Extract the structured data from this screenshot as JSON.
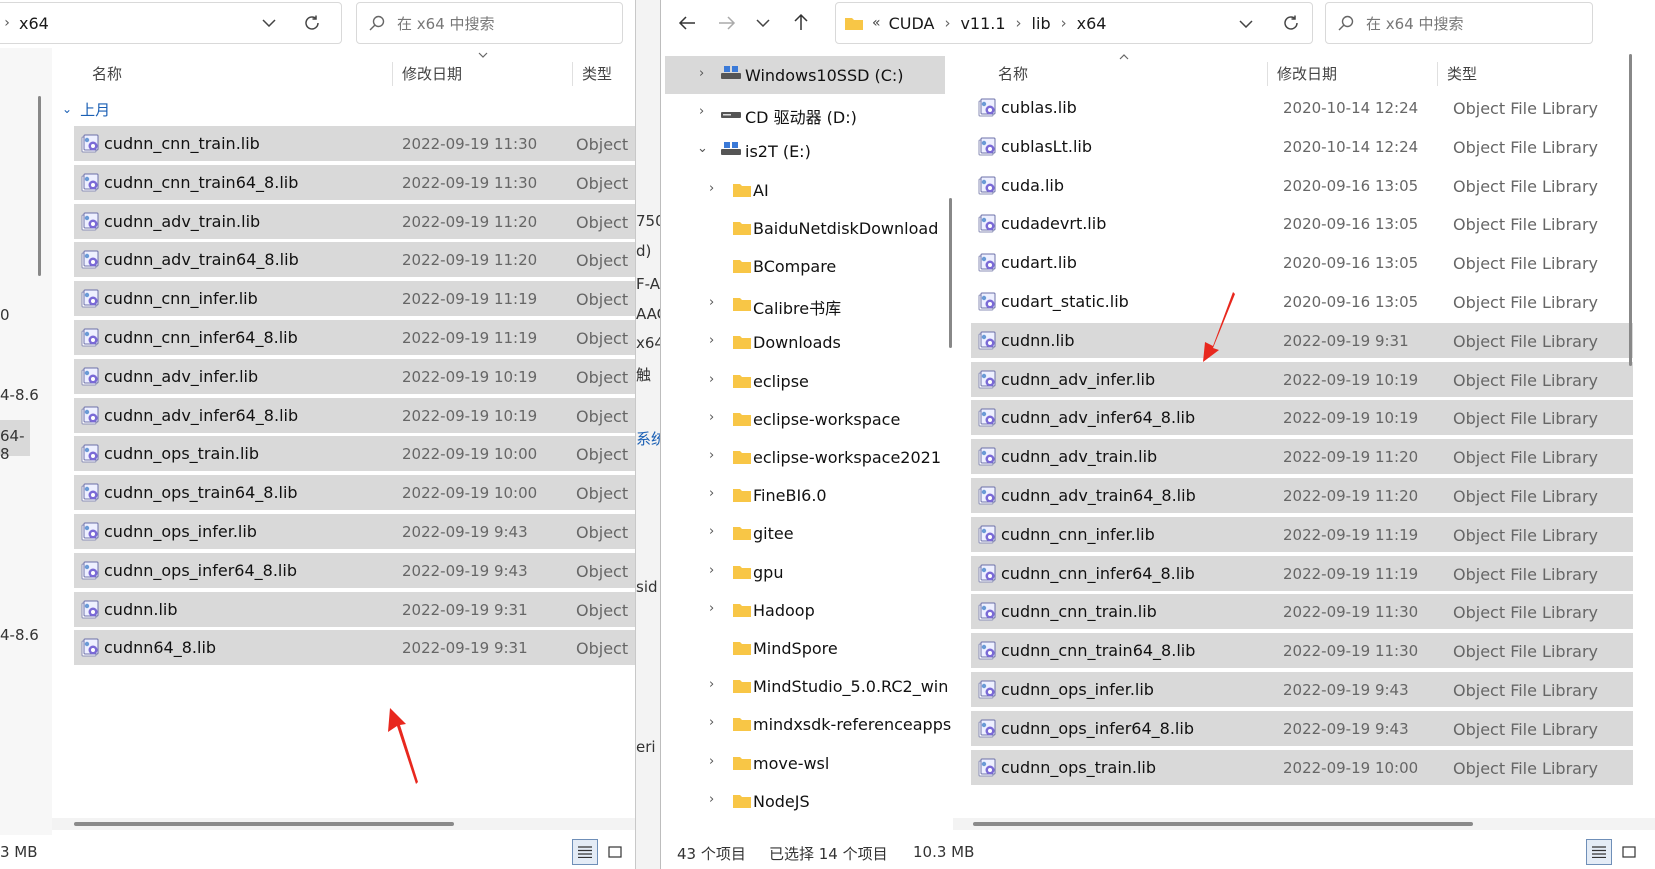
{
  "left": {
    "address": {
      "crumb": "x64"
    },
    "search": {
      "placeholder": "在 x64 中搜索"
    },
    "columns": {
      "name": "名称",
      "date": "修改日期",
      "type": "类型"
    },
    "group": {
      "label": "上月"
    },
    "files": [
      {
        "name": "cudnn_cnn_train.lib",
        "date": "2022-09-19 11:30",
        "type": "Object"
      },
      {
        "name": "cudnn_cnn_train64_8.lib",
        "date": "2022-09-19 11:30",
        "type": "Object"
      },
      {
        "name": "cudnn_adv_train.lib",
        "date": "2022-09-19 11:20",
        "type": "Object"
      },
      {
        "name": "cudnn_adv_train64_8.lib",
        "date": "2022-09-19 11:20",
        "type": "Object"
      },
      {
        "name": "cudnn_cnn_infer.lib",
        "date": "2022-09-19 11:19",
        "type": "Object"
      },
      {
        "name": "cudnn_cnn_infer64_8.lib",
        "date": "2022-09-19 11:19",
        "type": "Object"
      },
      {
        "name": "cudnn_adv_infer.lib",
        "date": "2022-09-19 10:19",
        "type": "Object"
      },
      {
        "name": "cudnn_adv_infer64_8.lib",
        "date": "2022-09-19 10:19",
        "type": "Object"
      },
      {
        "name": "cudnn_ops_train.lib",
        "date": "2022-09-19 10:00",
        "type": "Object"
      },
      {
        "name": "cudnn_ops_train64_8.lib",
        "date": "2022-09-19 10:00",
        "type": "Object"
      },
      {
        "name": "cudnn_ops_infer.lib",
        "date": "2022-09-19 9:43",
        "type": "Object"
      },
      {
        "name": "cudnn_ops_infer64_8.lib",
        "date": "2022-09-19 9:43",
        "type": "Object"
      },
      {
        "name": "cudnn.lib",
        "date": "2022-09-19 9:31",
        "type": "Object"
      },
      {
        "name": "cudnn64_8.lib",
        "date": "2022-09-19 9:31",
        "type": "Object"
      }
    ],
    "status": {
      "size": "3 MB"
    },
    "edge_fragments": [
      "0",
      "4-8.6",
      "64-8",
      "4-8.6"
    ]
  },
  "background_fragments": [
    "750",
    "d)",
    "F-A",
    "AAC",
    "x64",
    "触",
    "系统",
    "sid",
    "eri"
  ],
  "right": {
    "address": {
      "overflow": "«",
      "crumbs": [
        "CUDA",
        "v11.1",
        "lib",
        "x64"
      ]
    },
    "search": {
      "placeholder": "在 x64 中搜索"
    },
    "columns": {
      "name": "名称",
      "date": "修改日期",
      "type": "类型"
    },
    "tree": [
      {
        "label": "Windows10SSD (C:)",
        "kind": "drive",
        "expand": "right",
        "selected": true
      },
      {
        "label": "CD 驱动器 (D:)",
        "kind": "cd",
        "expand": "right"
      },
      {
        "label": "is2T (E:)",
        "kind": "drive",
        "expand": "down"
      },
      {
        "label": "AI",
        "kind": "folder",
        "expand": "right"
      },
      {
        "label": "BaiduNetdiskDownload",
        "kind": "folder",
        "expand": ""
      },
      {
        "label": "BCompare",
        "kind": "folder",
        "expand": ""
      },
      {
        "label": "Calibre书库",
        "kind": "folder",
        "expand": "right"
      },
      {
        "label": "Downloads",
        "kind": "folder",
        "expand": "right"
      },
      {
        "label": "eclipse",
        "kind": "folder",
        "expand": "right"
      },
      {
        "label": "eclipse-workspace",
        "kind": "folder",
        "expand": "right"
      },
      {
        "label": "eclipse-workspace2021",
        "kind": "folder",
        "expand": "right"
      },
      {
        "label": "FineBI6.0",
        "kind": "folder",
        "expand": "right"
      },
      {
        "label": "gitee",
        "kind": "folder",
        "expand": "right"
      },
      {
        "label": "gpu",
        "kind": "folder",
        "expand": "right"
      },
      {
        "label": "Hadoop",
        "kind": "folder",
        "expand": "right"
      },
      {
        "label": "MindSpore",
        "kind": "folder",
        "expand": ""
      },
      {
        "label": "MindStudio_5.0.RC2_win",
        "kind": "folder",
        "expand": "right"
      },
      {
        "label": "mindxsdk-referenceapps",
        "kind": "folder",
        "expand": "right"
      },
      {
        "label": "move-wsl",
        "kind": "folder",
        "expand": "right"
      },
      {
        "label": "NodeJS",
        "kind": "folder",
        "expand": "right"
      }
    ],
    "files": [
      {
        "name": "cublas.lib",
        "date": "2020-10-14 12:24",
        "type": "Object File Library",
        "selected": false
      },
      {
        "name": "cublasLt.lib",
        "date": "2020-10-14 12:24",
        "type": "Object File Library",
        "selected": false
      },
      {
        "name": "cuda.lib",
        "date": "2020-09-16 13:05",
        "type": "Object File Library",
        "selected": false
      },
      {
        "name": "cudadevrt.lib",
        "date": "2020-09-16 13:05",
        "type": "Object File Library",
        "selected": false
      },
      {
        "name": "cudart.lib",
        "date": "2020-09-16 13:05",
        "type": "Object File Library",
        "selected": false
      },
      {
        "name": "cudart_static.lib",
        "date": "2020-09-16 13:05",
        "type": "Object File Library",
        "selected": false
      },
      {
        "name": "cudnn.lib",
        "date": "2022-09-19 9:31",
        "type": "Object File Library",
        "selected": true
      },
      {
        "name": "cudnn_adv_infer.lib",
        "date": "2022-09-19 10:19",
        "type": "Object File Library",
        "selected": true
      },
      {
        "name": "cudnn_adv_infer64_8.lib",
        "date": "2022-09-19 10:19",
        "type": "Object File Library",
        "selected": true
      },
      {
        "name": "cudnn_adv_train.lib",
        "date": "2022-09-19 11:20",
        "type": "Object File Library",
        "selected": true
      },
      {
        "name": "cudnn_adv_train64_8.lib",
        "date": "2022-09-19 11:20",
        "type": "Object File Library",
        "selected": true
      },
      {
        "name": "cudnn_cnn_infer.lib",
        "date": "2022-09-19 11:19",
        "type": "Object File Library",
        "selected": true
      },
      {
        "name": "cudnn_cnn_infer64_8.lib",
        "date": "2022-09-19 11:19",
        "type": "Object File Library",
        "selected": true
      },
      {
        "name": "cudnn_cnn_train.lib",
        "date": "2022-09-19 11:30",
        "type": "Object File Library",
        "selected": true
      },
      {
        "name": "cudnn_cnn_train64_8.lib",
        "date": "2022-09-19 11:30",
        "type": "Object File Library",
        "selected": true
      },
      {
        "name": "cudnn_ops_infer.lib",
        "date": "2022-09-19 9:43",
        "type": "Object File Library",
        "selected": true
      },
      {
        "name": "cudnn_ops_infer64_8.lib",
        "date": "2022-09-19 9:43",
        "type": "Object File Library",
        "selected": true
      },
      {
        "name": "cudnn_ops_train.lib",
        "date": "2022-09-19 10:00",
        "type": "Object File Library",
        "selected": true
      }
    ],
    "status": {
      "count": "43 个项目",
      "selected": "已选择 14 个项目",
      "size": "10.3 MB"
    }
  },
  "colors": {
    "selection": "#d9d9d9",
    "folder": "#f8c646",
    "arrow": "#e8281e",
    "tree_selected": "#d9d9d9"
  }
}
